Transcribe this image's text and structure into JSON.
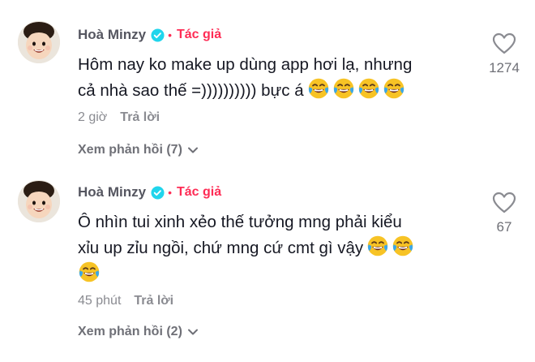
{
  "comments": [
    {
      "author": "Hoà Minzy",
      "badge": "Tác giả",
      "text_line1": "Hôm nay ko make up dùng app hơi lạ, nhưng",
      "text_line2": "cả nhà sao thế =)))))))))) bực á",
      "emoji": "face-with-tears-of-joy",
      "emoji_count": 4,
      "time": "2 giờ",
      "reply_label": "Trả lời",
      "view_replies": "Xem phản hồi (7)",
      "likes": "1274"
    },
    {
      "author": "Hoà Minzy",
      "badge": "Tác giả",
      "text_line1": "Ô nhìn tui xinh xẻo thế tưởng mng phải kiểu",
      "text_line2": "xỉu up zỉu ngồi, chứ mng cứ cmt gì vậy",
      "emoji": "face-with-tears-of-joy",
      "emoji_count": 3,
      "time": "45 phút",
      "reply_label": "Trả lời",
      "view_replies": "Xem phản hồi (2)",
      "likes": "67"
    }
  ],
  "colors": {
    "accent": "#fe2c55",
    "verified": "#20d5ec",
    "muted": "#8a8b91"
  }
}
